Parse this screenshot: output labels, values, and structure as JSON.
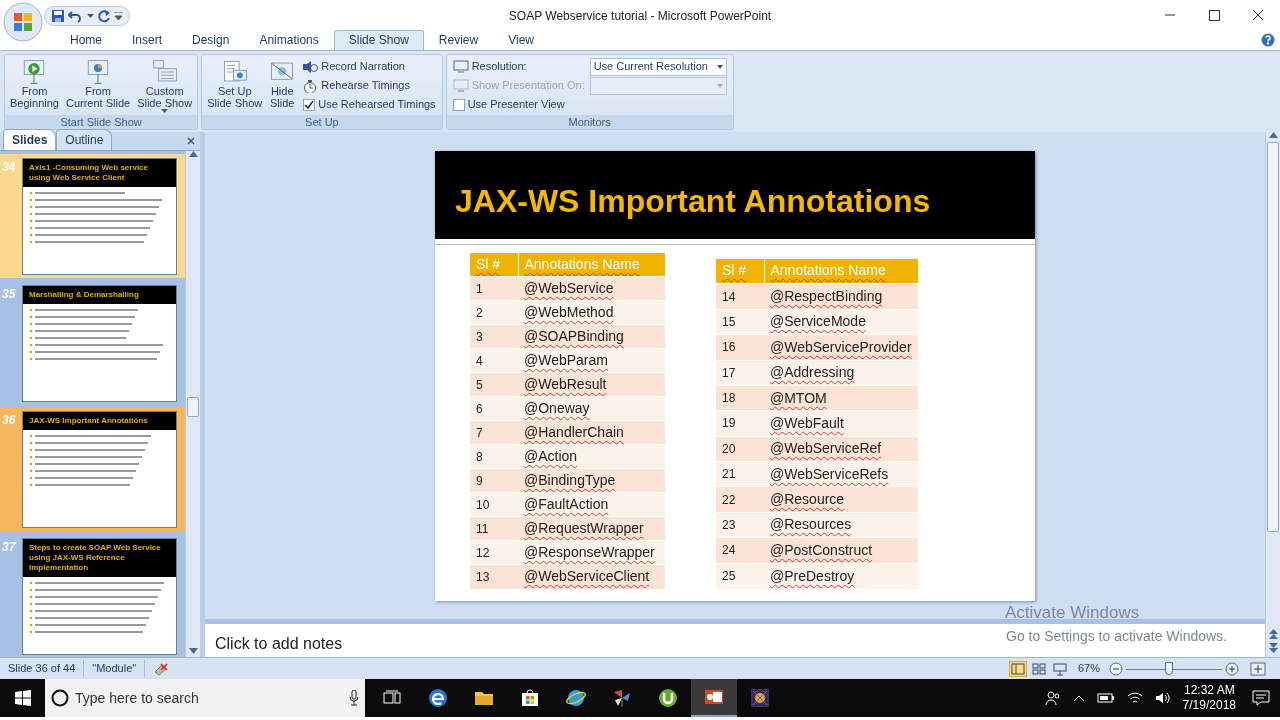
{
  "window": {
    "title": "SOAP Webservice tutorial - Microsoft PowerPoint"
  },
  "ribbon": {
    "tabs": [
      {
        "label": "Home",
        "selected": false
      },
      {
        "label": "Insert",
        "selected": false
      },
      {
        "label": "Design",
        "selected": false
      },
      {
        "label": "Animations",
        "selected": false
      },
      {
        "label": "Slide Show",
        "selected": true
      },
      {
        "label": "Review",
        "selected": false
      },
      {
        "label": "View",
        "selected": false
      }
    ],
    "groups": [
      {
        "label": "Start Slide Show",
        "items": [
          {
            "kind": "large",
            "label": "From\nBeginning"
          },
          {
            "kind": "large",
            "label": "From\nCurrent Slide"
          },
          {
            "kind": "large",
            "label": "Custom\nSlide Show",
            "dropdown": true
          }
        ]
      },
      {
        "label": "Set Up",
        "items": [
          {
            "kind": "large",
            "label": "Set Up\nSlide Show"
          },
          {
            "kind": "large",
            "label": "Hide\nSlide"
          },
          {
            "kind": "small",
            "label": "Record Narration"
          },
          {
            "kind": "small",
            "label": "Rehearse Timings"
          },
          {
            "kind": "checkbox",
            "label": "Use Rehearsed Timings",
            "checked": true
          }
        ]
      },
      {
        "label": "Monitors",
        "items": [
          {
            "kind": "dropdown",
            "label": "Resolution:",
            "value": "Use Current Resolution",
            "disabled": false
          },
          {
            "kind": "dropdown",
            "label": "Show Presentation On:",
            "disabled": true
          },
          {
            "kind": "checkbox",
            "label": "Use Presenter View",
            "checked": false
          }
        ]
      }
    ]
  },
  "side_panel": {
    "tabs": [
      {
        "label": "Slides",
        "selected": true
      },
      {
        "label": "Outline",
        "selected": false
      }
    ],
    "slides": [
      {
        "number": "34",
        "title": "Axis1 -Consuming Web service using Web Service Client",
        "selected": false,
        "hovered": true
      },
      {
        "number": "35",
        "title": "Marshalling & Demarshalling",
        "selected": false,
        "hovered": false
      },
      {
        "number": "36",
        "title": "JAX-WS Important Annotations",
        "selected": true,
        "hovered": false
      },
      {
        "number": "37",
        "title": "Steps to create SOAP Web Service using JAX-WS Reference Implementation",
        "selected": false,
        "hovered": false
      }
    ]
  },
  "slide": {
    "title": "JAX-WS Important Annotations",
    "tables": [
      {
        "columns": [
          "Sl #",
          "Annotations Name"
        ],
        "rows": [
          [
            "1",
            "@WebService"
          ],
          [
            "2",
            "@WebMethod"
          ],
          [
            "3",
            "@SOAPBinding"
          ],
          [
            "4",
            "@WebParam"
          ],
          [
            "5",
            "@WebResult"
          ],
          [
            "6",
            "@Oneway"
          ],
          [
            "7",
            "@HandlerChain"
          ],
          [
            "8",
            "@Action"
          ],
          [
            "9",
            "@BindingType"
          ],
          [
            "10",
            "@FaultAction"
          ],
          [
            "11",
            "@RequestWrapper"
          ],
          [
            "12",
            "@ResponseWrapper"
          ],
          [
            "13",
            "@WebServiceClient"
          ]
        ]
      },
      {
        "columns": [
          "Sl #",
          "Annotations Name"
        ],
        "rows": [
          [
            "14",
            "@RespectBinding"
          ],
          [
            "15",
            "@ServiceMode"
          ],
          [
            "16",
            "@WebServiceProvider"
          ],
          [
            "17",
            "@Addressing"
          ],
          [
            "18",
            "@MTOM"
          ],
          [
            "19",
            "@WebFault"
          ],
          [
            "20",
            "@WebServiceRef"
          ],
          [
            "21",
            "@WebServiceRefs"
          ],
          [
            "22",
            "@Resource"
          ],
          [
            "23",
            "@Resources"
          ],
          [
            "24",
            "@PostConstruct"
          ],
          [
            "25",
            "@PreDestroy"
          ]
        ]
      }
    ]
  },
  "notes": {
    "placeholder": "Click to add notes"
  },
  "activation_notice": {
    "title": "Activate Windows",
    "message": "Go to Settings to activate Windows."
  },
  "status_bar": {
    "slide_position": "Slide 36 of 44",
    "theme": "\"Module\"",
    "zoom": "67%",
    "zoom_slider": {
      "level": 0.45
    },
    "views": [
      {
        "kind": "normal",
        "selected": true
      },
      {
        "kind": "sorter",
        "selected": false
      },
      {
        "kind": "show",
        "selected": false
      }
    ]
  },
  "taskbar": {
    "search": {
      "placeholder": "Type here to search"
    },
    "apps": [
      {
        "kind": "edge",
        "active": false
      },
      {
        "kind": "explorer",
        "active": false
      },
      {
        "kind": "store",
        "active": false
      },
      {
        "kind": "ie",
        "active": false
      },
      {
        "kind": "pinwheel",
        "active": false
      },
      {
        "kind": "torrent",
        "active": false
      },
      {
        "kind": "powerpoint",
        "active": true
      },
      {
        "kind": "game",
        "active": false
      }
    ],
    "time": "12:32 AM",
    "date": "7/19/2018"
  }
}
